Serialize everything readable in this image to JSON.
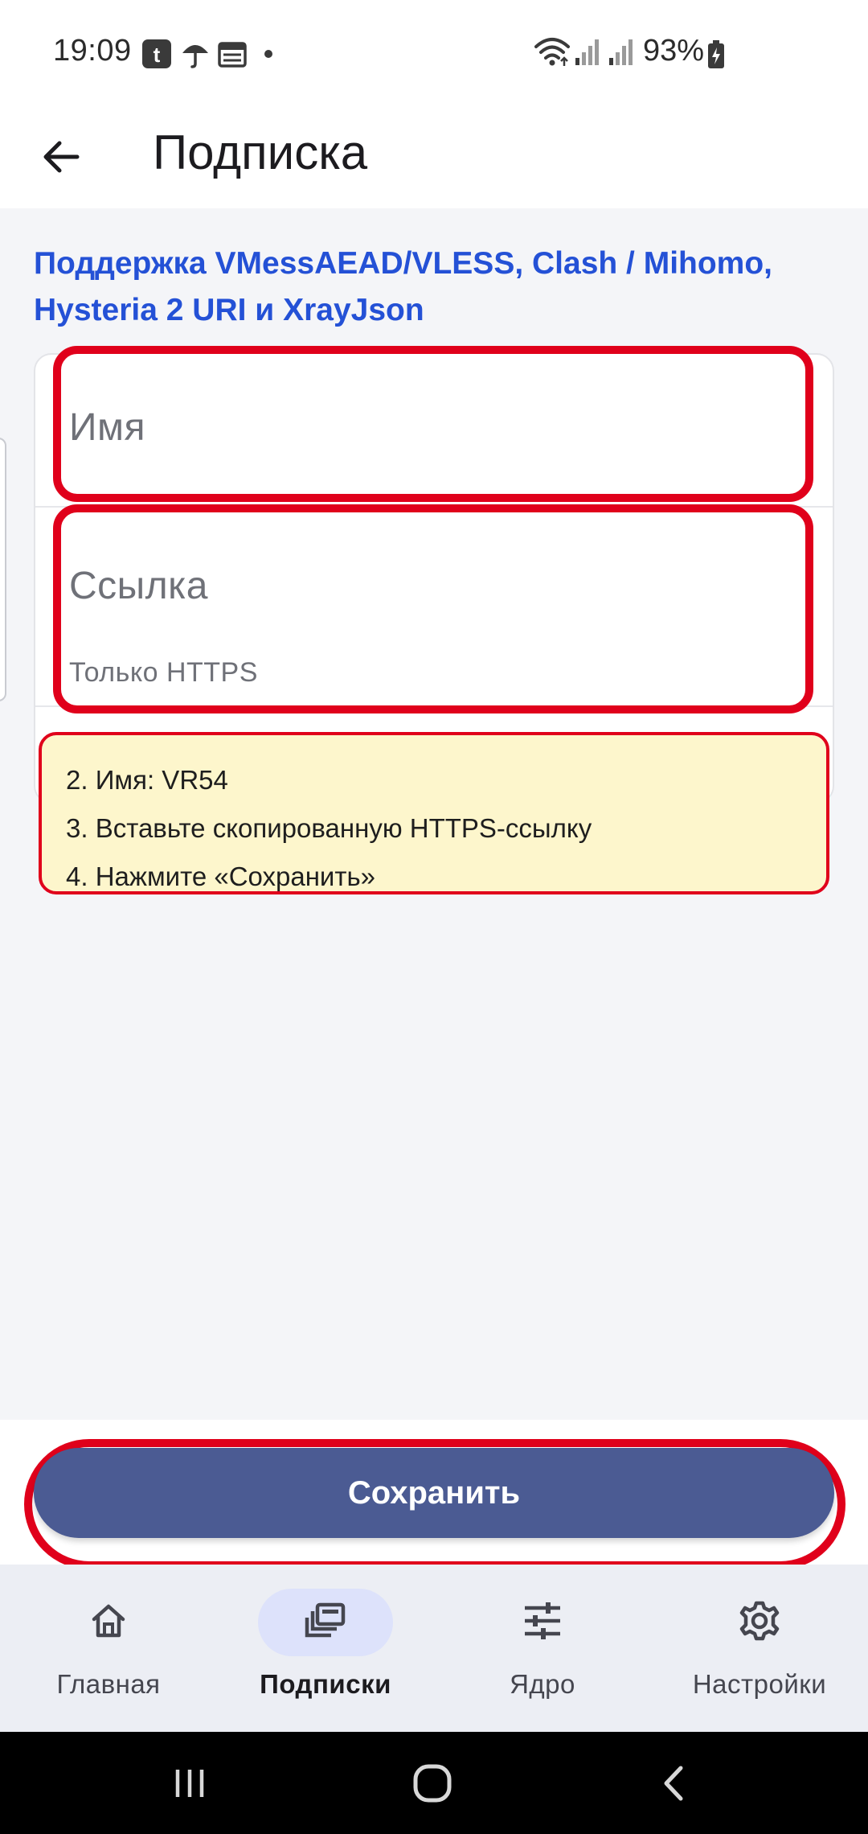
{
  "status_bar": {
    "time": "19:09",
    "battery_percent": "93%",
    "icons": [
      "tumblr-notification-icon",
      "umbrella-icon",
      "calendar-icon",
      "dot-icon",
      "wifi-icon",
      "signal-icon",
      "signal-icon",
      "battery-charging-icon"
    ]
  },
  "app_bar": {
    "title": "Подписка",
    "back_icon": "arrow-left-icon"
  },
  "form": {
    "support_text": "Поддержка VMessAEAD/VLESS, Clash / Mihomo, Hysteria 2 URI и XrayJson",
    "name_field": {
      "placeholder": "Имя",
      "value": ""
    },
    "url_field": {
      "placeholder": "Ссылка",
      "value": "",
      "helper": "Только HTTPS"
    }
  },
  "hint": {
    "lines": [
      "2. Имя: VR54",
      "3. Вставьте скопированную HTTPS-ссылку",
      "4. Нажмите «Сохранить»"
    ]
  },
  "save_label": "Сохранить",
  "bottom_nav": {
    "items": [
      {
        "label": "Главная",
        "icon": "home-icon",
        "active": false
      },
      {
        "label": "Подписки",
        "icon": "subscriptions-icon",
        "active": true
      },
      {
        "label": "Ядро",
        "icon": "sliders-icon",
        "active": false
      },
      {
        "label": "Настройки",
        "icon": "gear-icon",
        "active": false
      }
    ]
  },
  "colors": {
    "accent_text": "#2451d6",
    "primary_button": "#4b5b93",
    "highlight_border": "#e0001b",
    "hint_background": "#fdf6cc",
    "active_nav_pill": "#dde2fb"
  }
}
